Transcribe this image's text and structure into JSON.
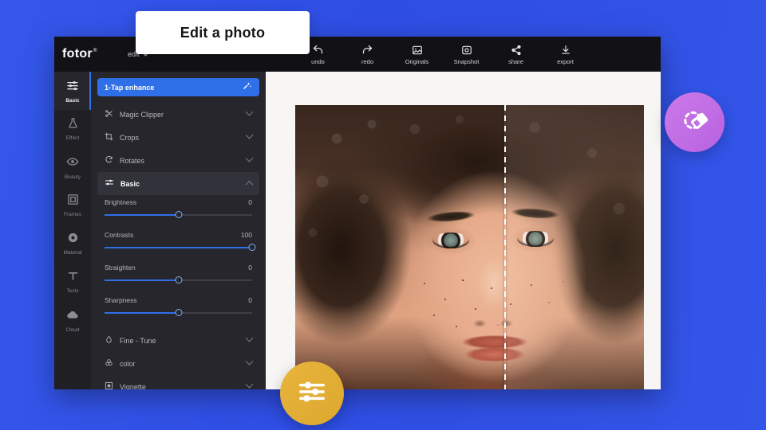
{
  "theme": {
    "background_blue": "#3150E8",
    "accent_blue": "#2F6FE8",
    "window_dark": "#1B1B1F",
    "panel_dark": "#26262C",
    "rail_dark": "#1F1F24",
    "badge_purple": "#BC68E2",
    "badge_yellow": "#E0AA33",
    "canvas_white": "#F7F6F4"
  },
  "tooltip": {
    "text": "Edit a photo"
  },
  "app": {
    "brand": {
      "name": "fotor",
      "registered_mark": "®"
    },
    "menu": {
      "label": "edit"
    },
    "toolbar": [
      {
        "label": "undo",
        "icon": "undo-arrow-icon"
      },
      {
        "label": "redo",
        "icon": "redo-arrow-icon"
      },
      {
        "label": "Originals",
        "icon": "image-icon"
      },
      {
        "label": "Snapshot",
        "icon": "camera-icon"
      },
      {
        "label": "share",
        "icon": "share-nodes-icon"
      },
      {
        "label": "export",
        "icon": "download-icon"
      }
    ]
  },
  "rail": {
    "items": [
      {
        "label": "Basic",
        "icon": "sliders-icon",
        "active": true
      },
      {
        "label": "Effect",
        "icon": "flask-icon",
        "active": false
      },
      {
        "label": "Beauty",
        "icon": "eye-icon",
        "active": false
      },
      {
        "label": "Frames",
        "icon": "frame-icon",
        "active": false
      },
      {
        "label": "Material",
        "icon": "sticker-icon",
        "active": false
      },
      {
        "label": "Texts",
        "icon": "text-t-icon",
        "active": false
      },
      {
        "label": "Cloud",
        "icon": "cloud-icon",
        "active": false
      }
    ]
  },
  "panel": {
    "enhance": {
      "label": "1-Tap enhance",
      "icon": "magic-wand-icon"
    },
    "rows_top": [
      {
        "label": "Magic Clipper",
        "icon": "scissors-icon",
        "expanded": false
      },
      {
        "label": "Crops",
        "icon": "crop-icon",
        "expanded": false
      },
      {
        "label": "Rotates",
        "icon": "rotate-right-icon",
        "expanded": false
      },
      {
        "label": "Basic",
        "icon": "sliders-icon",
        "expanded": true
      }
    ],
    "sliders": [
      {
        "name": "Brightness",
        "value": "0",
        "percent": 50
      },
      {
        "name": "Contrasts",
        "value": "100",
        "percent": 100
      },
      {
        "name": "Straighten",
        "value": "0",
        "percent": 50
      },
      {
        "name": "Sharpness",
        "value": "0",
        "percent": 50
      }
    ],
    "rows_bottom": [
      {
        "label": "Fine - Tune",
        "icon": "droplet-icon",
        "expanded": false
      },
      {
        "label": "color",
        "icon": "palette-icon",
        "expanded": false
      },
      {
        "label": "Vignette",
        "icon": "vignette-icon",
        "expanded": false
      }
    ]
  },
  "canvas": {
    "photo_alt": "portrait of a woman with curly hair, before/after comparison",
    "split_divider": "dashed-vertical-line"
  },
  "badges": [
    {
      "name": "eraser-badge",
      "icon": "eraser-icon"
    },
    {
      "name": "sliders-badge",
      "icon": "sliders-icon"
    }
  ]
}
